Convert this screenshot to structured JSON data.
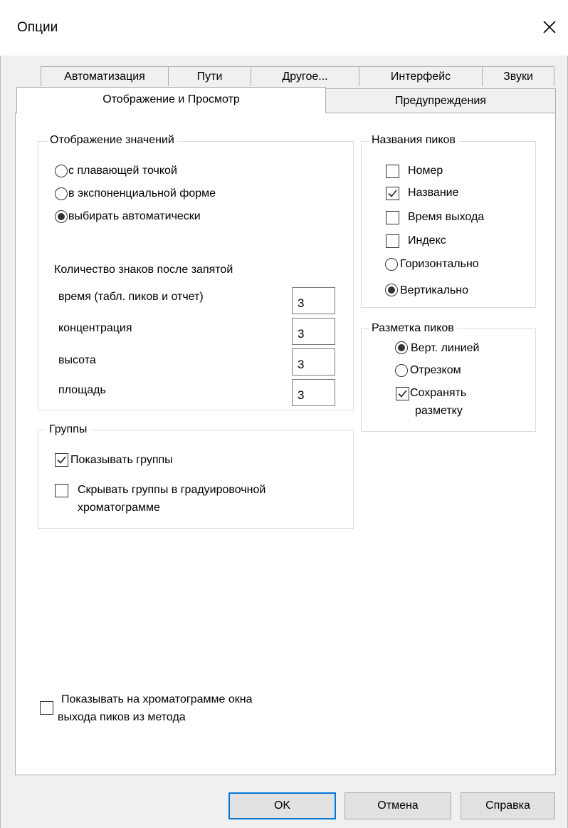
{
  "window": {
    "title": "Опции"
  },
  "tabs": {
    "row1": [
      "Автоматизация",
      "Пути",
      "Другое...",
      "Интерфейс",
      "Звуки"
    ],
    "row2": [
      "Отображение и Просмотр",
      "Предупреждения"
    ],
    "active": "Отображение и Просмотр"
  },
  "value_display": {
    "legend": "Отображение значений",
    "options": [
      {
        "label": "с плавающей точкой",
        "selected": false
      },
      {
        "label": "в экспоненциальной форме",
        "selected": false
      },
      {
        "label": "выбирать автоматически",
        "selected": true
      }
    ],
    "decimals_heading": "Количество знаков после запятой",
    "decimals": [
      {
        "label": "время (табл. пиков и отчет)",
        "value": "3"
      },
      {
        "label": "концентрация",
        "value": "3"
      },
      {
        "label": "высота",
        "value": "3"
      },
      {
        "label": "площадь",
        "value": "3"
      }
    ]
  },
  "peak_names": {
    "legend": "Названия пиков",
    "checkboxes": [
      {
        "label": "Номер",
        "checked": false
      },
      {
        "label": "Название",
        "checked": true
      },
      {
        "label": "Время выхода",
        "checked": false
      },
      {
        "label": "Индекс",
        "checked": false
      }
    ],
    "orientation": [
      {
        "label": "Горизонтально",
        "selected": false
      },
      {
        "label": "Вертикально",
        "selected": true
      }
    ]
  },
  "peak_marking": {
    "legend": "Разметка пиков",
    "options": [
      {
        "label": "Верт. линией",
        "selected": true
      },
      {
        "label": "Отрезком",
        "selected": false
      }
    ],
    "save_label_line1": "Сохранять",
    "save_label_line2": "разметку",
    "save_checked": true
  },
  "groups": {
    "legend": "Группы",
    "show_label": "Показывать группы",
    "show_checked": true,
    "hide_label_line1": "Скрывать группы в градуировочной",
    "hide_label_line2": "хроматограмме",
    "hide_checked": false
  },
  "show_windows": {
    "label_line1": "Показывать на хроматограмме окна",
    "label_line2": "выхода пиков из метода",
    "checked": false
  },
  "buttons": {
    "ok": "OK",
    "cancel": "Отмена",
    "help": "Справка"
  }
}
